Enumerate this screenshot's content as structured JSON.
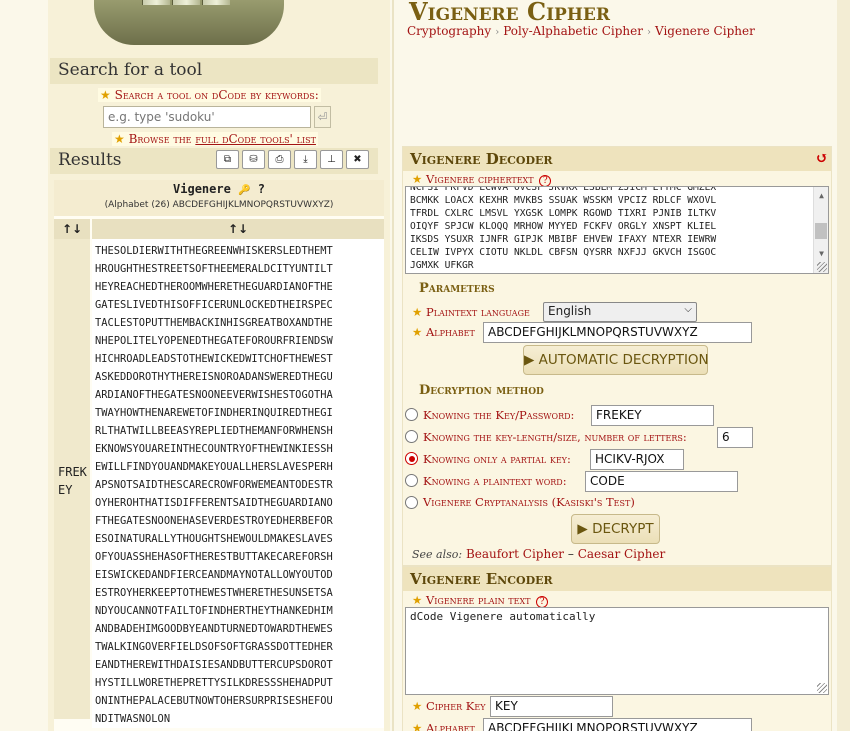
{
  "sidebar": {
    "search_title": "Search for a tool",
    "search_label": "Search a tool on dCode by keywords:",
    "search_placeholder": "e.g. type 'sudoku'",
    "search_button": "⏎",
    "browse_prefix": "Browse the",
    "browse_link": "full dCode tools' list",
    "results_title": "Results",
    "toolbar": [
      "⧉",
      "⛁",
      "⎙",
      "⤓",
      "⊥",
      "✖"
    ],
    "results_header_title": "Vigenere",
    "results_key_icon": "🔑",
    "results_question": "?",
    "results_alphabet": "(Alphabet (26) ABCDEFGHIJKLMNOPQRSTUVWXYZ)",
    "col_key_head": "↑↓",
    "col_text_head": "↑↓",
    "result_key": [
      "FREK",
      "EY"
    ],
    "result_lines": [
      "THESOLDIERWITHTHEGREENWHISKERSLEDTHEMT",
      "HROUGHTHESTREETSOFTHEEMERALDCITYUNTILT",
      "HEYREACHEDTHEROOMWHERETHEGUARDIANOFTHE",
      "GATESLIVEDTHISOFFICERUNLOCKEDTHEIRSPEC",
      "TACLESTOPUTTHEMBACKINHISGREATBOXANDTHE",
      "NHEPOLITELYOPENEDTHEGATEFOROURFRIENDSW",
      "HICHROADLEADSTOTHEWICKEDWITCHOFTHEWEST",
      "ASKEDDOROTHYTHEREISNOROADANSWEREDTHEGU",
      "ARDIANOFTHEGATESNOONEEVERWISHESTOGOTHA",
      "TWAYHOWTHENAREWETOFINDHERINQUIREDTHEGI",
      "RLTHATWILLBEEASYREPLIEDTHEMANFORWHENSH",
      "EKNOWSYOUAREINTHECOUNTRYOFTHEWINKIESSH",
      "EWILLFINDYOUANDMAKEYOUALLHERSLAVESPERH",
      "APSNOTSAIDTHESCARECROWFORWEMEANTODESTR",
      "OYHEROHTHATISDIFFERENTSAIDTHEGUARDIANO",
      "FTHEGATESNOONEHASEVERDESTROYEDHERBEFOR",
      "ESOINATURALLYTHOUGHTSHEWOULDMAKESLAVES",
      "OFYOUASSHEHASOFTHERESTBUTTAKECAREFORSH",
      "EISWICKEDANDFIERCEANDMAYNOTALLOWYOUTOD",
      "ESTROYHERKEEPTOTHEWESTWHERETHESUNSETSA",
      "NDYOUCANNOTFAILTOFINDHERTHEYTHANKEDHIM",
      "ANDBADEHIMGOODBYEANDTURNEDTOWARDTHEWES",
      "TWALKINGOVERFIELDSOFSOFTGRASSDOTTEDHER",
      "EANDTHEREWITHDAISIESANDBUTTERCUPSDOROT",
      "HYSTILLWORETHEPRETTYSILKDRESSSHEHADPUT",
      "ONINTHEPALACEBUTNOWTOHERSURPRISESHEFOU",
      "NDITWASNOLON"
    ]
  },
  "main": {
    "title": "Vigenere Cipher",
    "breadcrumb": [
      "Cryptography",
      "Poly-Alphabetic Cipher",
      "Vigenere Cipher"
    ],
    "decoder": {
      "title": "Vigenere Decoder",
      "reset_icon": "↺",
      "ciphertext_label": "Vigenere ciphertext",
      "ciphertext_lines": [
        "NCPSI PKFVD LCWVA OVCSF JKVKX ESBLM ZJICM LYYMC GMZEX",
        "BCMKK LOACX KEXHR MVKBS SSUAK WSSKM VPCIZ RDLCF WXOVL",
        "TFRDL CXLRC LMSVL YXGSK LOMPK RGOWD TIXRI PJNIB ILTKV",
        "OIQYF SPJCW KLOQQ MRHOW MYYED FCKFV ORGLY XNSPT KLIEL",
        "IKSDS YSUXR IJNFR GIPJK MBIBF EHVEW IFAXY NTEXR IEWRW",
        "CELIW IVPYX CIOTU NKLDL CBFSN QYSRR NXFJJ GKVCH ISGOC",
        "JGMXK UFKGR"
      ],
      "params_title": "Parameters",
      "plaintext_language_label": "Plaintext language",
      "plaintext_language_value": "English",
      "alphabet_label": "Alphabet",
      "alphabet_value": "ABCDEFGHIJKLMNOPQRSTUVWXYZ",
      "auto_button": "▶ AUTOMATIC DECRYPTION",
      "method_title": "Decryption method",
      "method_key_label": "Knowing the Key/Password:",
      "method_key_value": "FREKEY",
      "method_length_label": "Knowing the key-length/size, number of letters:",
      "method_length_value": "6",
      "method_partial_label": "Knowing only a partial key:",
      "method_partial_value": "HCIKV-RJOX",
      "method_plainword_label": "Knowing a plaintext word:",
      "method_plainword_value": "CODE",
      "method_kasiski_label": "Vigenere Cryptanalysis (Kasiski's Test)",
      "decrypt_button": "▶ DECRYPT",
      "see_also_label": "See also:",
      "see_also_1": "Beaufort Cipher",
      "see_also_sep": " – ",
      "see_also_2": "Caesar Cipher"
    },
    "encoder": {
      "title": "Vigenere Encoder",
      "plaintext_label": "Vigenere plain text",
      "plaintext_value": "dCode Vigenere automatically",
      "cipher_key_label": "Cipher Key",
      "cipher_key_value": "KEY",
      "alphabet_label": "Alphabet",
      "alphabet_value": "ABCDEFGHIJKLMNOPQRSTUVWXYZ"
    }
  },
  "colors": {
    "link": "#a31313",
    "title": "#7a5f12",
    "panel_head": "#eee3bd"
  }
}
